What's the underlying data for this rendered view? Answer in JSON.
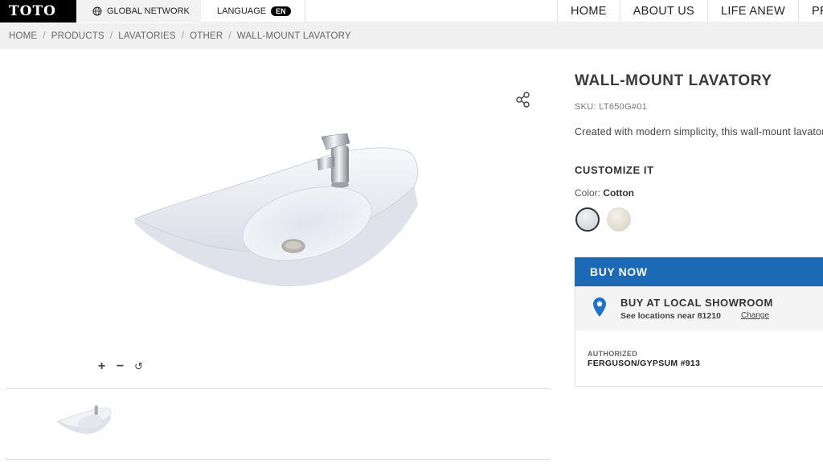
{
  "header": {
    "logo": "TOTO",
    "global_network": "GLOBAL NETWORK",
    "language_label": "LANGUAGE",
    "language_code": "EN",
    "nav": [
      "HOME",
      "ABOUT US",
      "LIFE ANEW",
      "PR"
    ]
  },
  "breadcrumb": [
    "HOME",
    "PRODUCTS",
    "LAVATORIES",
    "OTHER",
    "WALL-MOUNT LAVATORY"
  ],
  "gallery": {
    "zoom_in": "+",
    "zoom_out": "−",
    "reset": "↺"
  },
  "product": {
    "title": "WALL-MOUNT LAVATORY",
    "sku": "SKU: LT650G#01",
    "description": "Created with modern simplicity, this wall-mount lavatory",
    "customize_heading": "CUSTOMIZE IT",
    "color_label": "Color:",
    "color_value": "Cotton",
    "swatches": [
      {
        "name": "Cotton",
        "color": "#e6e8ec",
        "selected": true
      },
      {
        "name": "Sedona Beige",
        "color": "#e8e1d2",
        "selected": false
      }
    ]
  },
  "purchase": {
    "buy_now": "BUY NOW",
    "showroom_title": "BUY AT LOCAL SHOWROOM",
    "showroom_sub": "See locations near 81210",
    "change_link": "Change",
    "authorized_label": "AUTHORIZED",
    "dealer": "FERGUSON/GYPSUM #913"
  },
  "colors": {
    "accent": "#1c69b5",
    "pin": "#1f72c4"
  }
}
